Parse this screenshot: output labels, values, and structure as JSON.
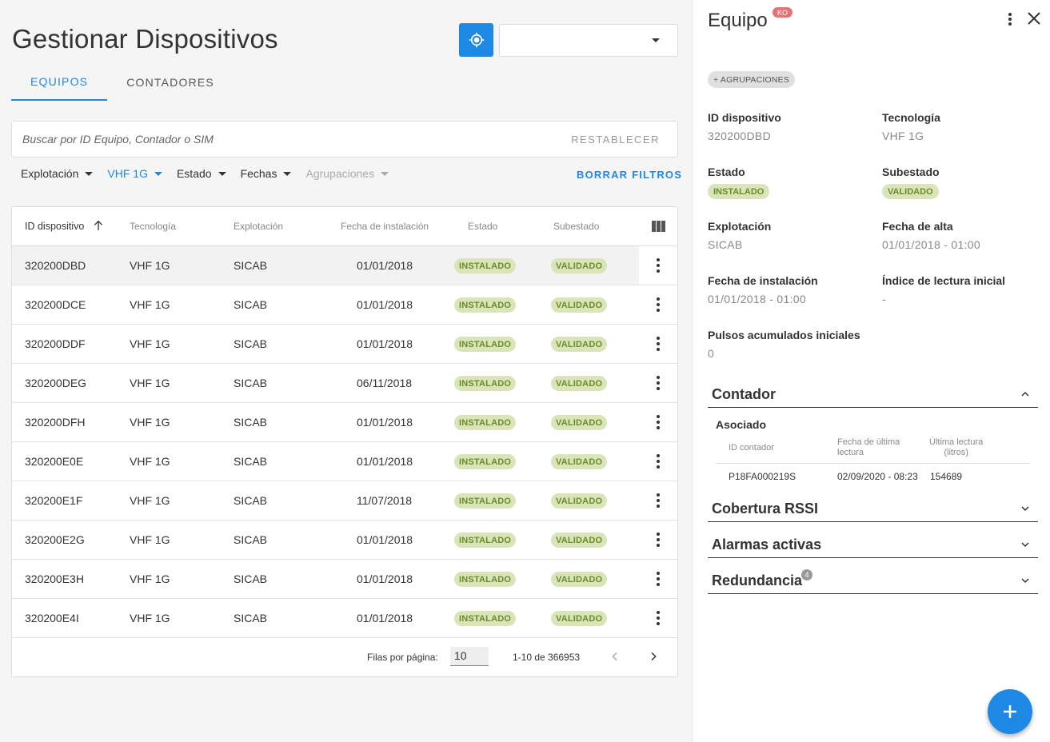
{
  "header": {
    "title": "Gestionar Dispositivos",
    "locate_icon": "crosshair-icon"
  },
  "tabs": [
    {
      "label": "EQUIPOS",
      "active": true
    },
    {
      "label": "CONTADORES",
      "active": false
    }
  ],
  "search": {
    "placeholder": "Buscar por ID Equipo, Contador o SIM",
    "value": "",
    "reset_label": "RESTABLECER"
  },
  "filters": [
    {
      "label": "Explotación",
      "state": "normal"
    },
    {
      "label": "VHF 1G",
      "state": "active"
    },
    {
      "label": "Estado",
      "state": "normal"
    },
    {
      "label": "Fechas",
      "state": "normal"
    },
    {
      "label": "Agrupaciones",
      "state": "disabled"
    }
  ],
  "clear_filters_label": "BORRAR FILTROS",
  "table": {
    "columns": [
      "ID dispositivo",
      "Tecnología",
      "Explotación",
      "Fecha de instalación",
      "Estado",
      "Subestado"
    ],
    "rows": [
      {
        "id": "320200DBD",
        "tech": "VHF 1G",
        "exp": "SICAB",
        "date": "01/01/2018",
        "estado": "INSTALADO",
        "subestado": "VALIDADO"
      },
      {
        "id": "320200DCE",
        "tech": "VHF 1G",
        "exp": "SICAB",
        "date": "01/01/2018",
        "estado": "INSTALADO",
        "subestado": "VALIDADO"
      },
      {
        "id": "320200DDF",
        "tech": "VHF 1G",
        "exp": "SICAB",
        "date": "01/01/2018",
        "estado": "INSTALADO",
        "subestado": "VALIDADO"
      },
      {
        "id": "320200DEG",
        "tech": "VHF 1G",
        "exp": "SICAB",
        "date": "06/11/2018",
        "estado": "INSTALADO",
        "subestado": "VALIDADO"
      },
      {
        "id": "320200DFH",
        "tech": "VHF 1G",
        "exp": "SICAB",
        "date": "01/01/2018",
        "estado": "INSTALADO",
        "subestado": "VALIDADO"
      },
      {
        "id": "320200E0E",
        "tech": "VHF 1G",
        "exp": "SICAB",
        "date": "01/01/2018",
        "estado": "INSTALADO",
        "subestado": "VALIDADO"
      },
      {
        "id": "320200E1F",
        "tech": "VHF 1G",
        "exp": "SICAB",
        "date": "11/07/2018",
        "estado": "INSTALADO",
        "subestado": "VALIDADO"
      },
      {
        "id": "320200E2G",
        "tech": "VHF 1G",
        "exp": "SICAB",
        "date": "01/01/2018",
        "estado": "INSTALADO",
        "subestado": "VALIDADO"
      },
      {
        "id": "320200E3H",
        "tech": "VHF 1G",
        "exp": "SICAB",
        "date": "01/01/2018",
        "estado": "INSTALADO",
        "subestado": "VALIDADO"
      },
      {
        "id": "320200E4I",
        "tech": "VHF 1G",
        "exp": "SICAB",
        "date": "01/01/2018",
        "estado": "INSTALADO",
        "subestado": "VALIDADO"
      }
    ],
    "footer": {
      "rows_label": "Filas por página:",
      "rows_value": "10",
      "range": "1-10 de 366953"
    }
  },
  "detail": {
    "title": "Equipo",
    "status_badge": "KO",
    "group_chip": "+ AGRUPACIONES",
    "fields": {
      "id_label": "ID dispositivo",
      "id_value": "320200DBD",
      "tech_label": "Tecnología",
      "tech_value": "VHF 1G",
      "estado_label": "Estado",
      "estado_value": "INSTALADO",
      "subestado_label": "Subestado",
      "subestado_value": "VALIDADO",
      "exp_label": "Explotación",
      "exp_value": "SICAB",
      "alta_label": "Fecha de alta",
      "alta_value": "01/01/2018 - 01:00",
      "inst_label": "Fecha de instalación",
      "inst_value": "01/01/2018 - 01:00",
      "indice_label": "Índice de lectura inicial",
      "indice_value": "-",
      "pulsos_label": "Pulsos acumulados iniciales",
      "pulsos_value": "0"
    },
    "contador": {
      "title": "Contador",
      "sub_label": "Asociado",
      "th_id": "ID contador",
      "th_fecha_1": "Fecha de última",
      "th_fecha_2": "lectura",
      "th_lectura_1": "Última lectura",
      "th_lectura_2": "(litros)",
      "row": {
        "id": "P18FA000219S",
        "fecha": "02/09/2020 - 08:23",
        "lectura": "154689"
      }
    },
    "sections": {
      "rssi": "Cobertura RSSI",
      "alarmas": "Alarmas activas",
      "redundancia": "Redundancia",
      "redundancia_count": "4"
    }
  },
  "colors": {
    "accent": "#1e88e5",
    "badge_bg": "#d9e5b8",
    "badge_fg": "#6b8b2a",
    "ko": "#e57373"
  }
}
